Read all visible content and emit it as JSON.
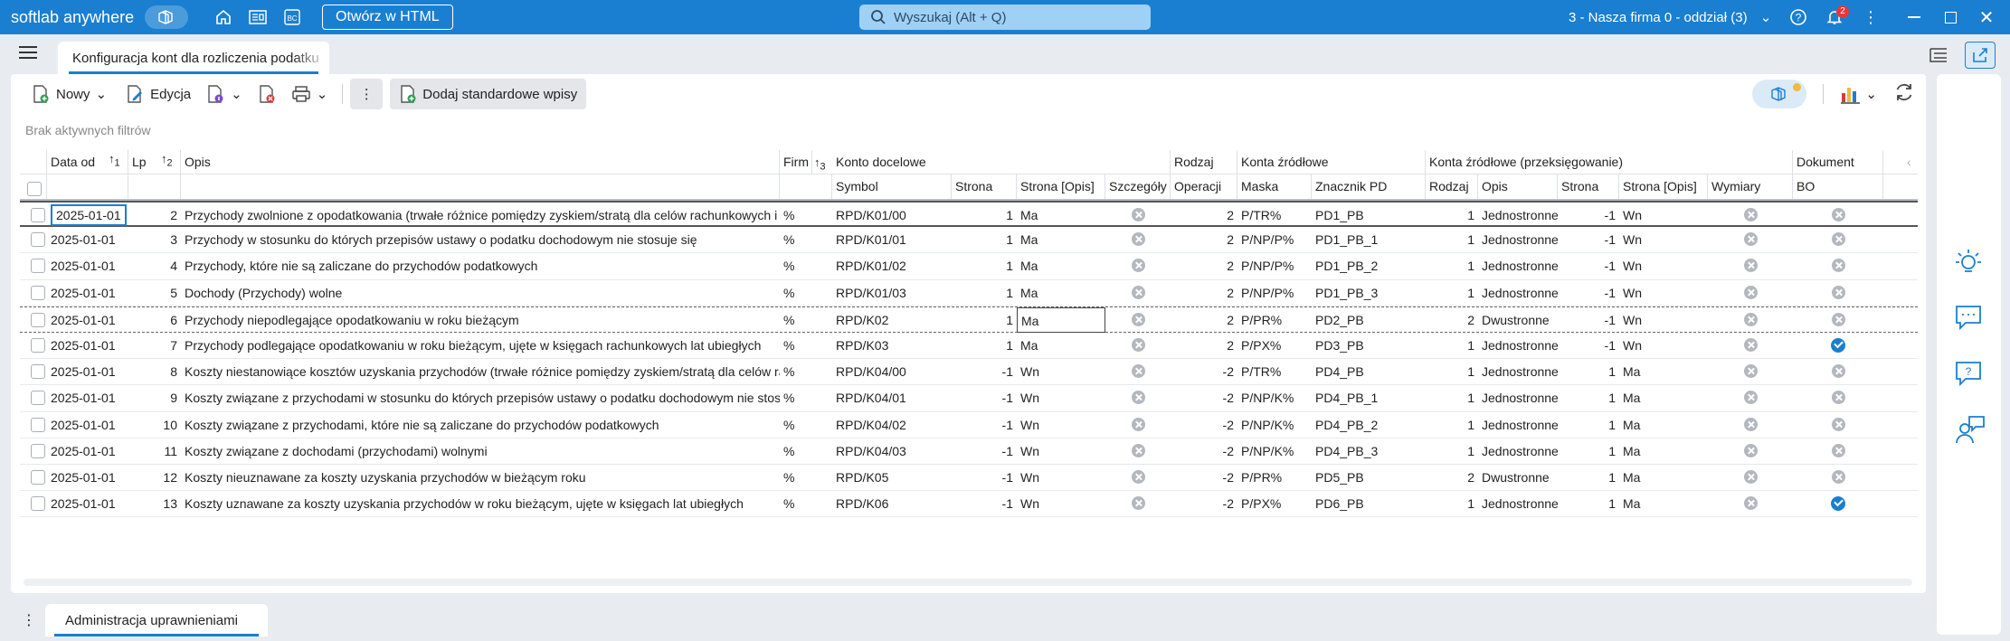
{
  "app": {
    "brand": "softlab anywhere",
    "html_button": "Otwórz w HTML",
    "search_placeholder": "Wyszukaj (Alt + Q)",
    "company": "3 - Nasza firma 0 - oddział (3)",
    "notifications": "2"
  },
  "tab": {
    "title": "Konfiguracja kont dla rozliczenia podatku"
  },
  "toolbar": {
    "new": "Nowy",
    "edit": "Edycja",
    "add_standard": "Dodaj standardowe wpisy"
  },
  "filters": "Brak aktywnych filtrów",
  "header_groups": {
    "data_od": "Data od",
    "lp": "Lp",
    "opis": "Opis",
    "firm": "Firm",
    "konto": "Konto docelowe",
    "rodzaj": "Rodzaj",
    "zrodlowe": "Konta źródłowe",
    "przeks": "Konta źródłowe (przeksięgowanie)",
    "dokument": "Dokument"
  },
  "sort_icons": {
    "data_od": "1",
    "lp": "2",
    "firm": "3"
  },
  "header_cols": {
    "symbol": "Symbol",
    "strona": "Strona",
    "strona_opis": "Strona [Opis]",
    "szczegoly": "Szczegóły",
    "operacji": "Operacji",
    "maska": "Maska",
    "znacznik": "Znacznik PD",
    "rodzaj2": "Rodzaj",
    "opis2": "Opis",
    "strona2": "Strona",
    "strona_opis2": "Strona [Opis]",
    "wymiary": "Wymiary",
    "bo": "BO"
  },
  "rows": [
    {
      "date": "2025-01-01",
      "lp": "2",
      "opis": "Przychody zwolnione z opodatkowania (trwałe różnice pomiędzy zyskiem/stratą dla celów rachunkowych i podatkowych)",
      "firm": "%",
      "symbol": "RPD/K01/00",
      "strona": "1",
      "strona_opis": "Ma",
      "operacji": "2",
      "maska": "P/TR%",
      "znacznik": "PD1_PB",
      "rodzaj": "1",
      "opis2": "Jednostronne",
      "strona2": "-1",
      "strona_opis2": "Wn",
      "bo": "x"
    },
    {
      "date": "2025-01-01",
      "lp": "3",
      "opis": "Przychody w stosunku do których przepisów ustawy o podatku dochodowym nie stosuje się",
      "firm": "%",
      "symbol": "RPD/K01/01",
      "strona": "1",
      "strona_opis": "Ma",
      "operacji": "2",
      "maska": "P/NP/P%",
      "znacznik": "PD1_PB_1",
      "rodzaj": "1",
      "opis2": "Jednostronne",
      "strona2": "-1",
      "strona_opis2": "Wn",
      "bo": "x"
    },
    {
      "date": "2025-01-01",
      "lp": "4",
      "opis": "Przychody, które nie są zaliczane do przychodów podatkowych",
      "firm": "%",
      "symbol": "RPD/K01/02",
      "strona": "1",
      "strona_opis": "Ma",
      "operacji": "2",
      "maska": "P/NP/P%",
      "znacznik": "PD1_PB_2",
      "rodzaj": "1",
      "opis2": "Jednostronne",
      "strona2": "-1",
      "strona_opis2": "Wn",
      "bo": "x"
    },
    {
      "date": "2025-01-01",
      "lp": "5",
      "opis": "Dochody (Przychody) wolne",
      "firm": "%",
      "symbol": "RPD/K01/03",
      "strona": "1",
      "strona_opis": "Ma",
      "operacji": "2",
      "maska": "P/NP/P%",
      "znacznik": "PD1_PB_3",
      "rodzaj": "1",
      "opis2": "Jednostronne",
      "strona2": "-1",
      "strona_opis2": "Wn",
      "bo": "x"
    },
    {
      "date": "2025-01-01",
      "lp": "6",
      "opis": "Przychody niepodlegające opodatkowaniu w roku bieżącym",
      "firm": "%",
      "symbol": "RPD/K02",
      "strona": "1",
      "strona_opis": "Ma",
      "operacji": "2",
      "maska": "P/PR%",
      "znacznik": "PD2_PB",
      "rodzaj": "2",
      "opis2": "Dwustronne",
      "strona2": "-1",
      "strona_opis2": "Wn",
      "bo": "x"
    },
    {
      "date": "2025-01-01",
      "lp": "7",
      "opis": "Przychody podlegające opodatkowaniu w roku bieżącym, ujęte w księgach rachunkowych lat ubiegłych",
      "firm": "%",
      "symbol": "RPD/K03",
      "strona": "1",
      "strona_opis": "Ma",
      "operacji": "2",
      "maska": "P/PX%",
      "znacznik": "PD3_PB",
      "rodzaj": "1",
      "opis2": "Jednostronne",
      "strona2": "-1",
      "strona_opis2": "Wn",
      "bo": "check"
    },
    {
      "date": "2025-01-01",
      "lp": "8",
      "opis": "Koszty niestanowiące kosztów uzyskania przychodów (trwałe różnice pomiędzy zyskiem/stratą dla celów rachunkowych)",
      "firm": "%",
      "symbol": "RPD/K04/00",
      "strona": "-1",
      "strona_opis": "Wn",
      "operacji": "-2",
      "maska": "P/TR%",
      "znacznik": "PD4_PB",
      "rodzaj": "1",
      "opis2": "Jednostronne",
      "strona2": "1",
      "strona_opis2": "Ma",
      "bo": "x"
    },
    {
      "date": "2025-01-01",
      "lp": "9",
      "opis": "Koszty związane z przychodami w stosunku do których przepisów ustawy o podatku dochodowym nie stosuje się",
      "firm": "%",
      "symbol": "RPD/K04/01",
      "strona": "-1",
      "strona_opis": "Wn",
      "operacji": "-2",
      "maska": "P/NP/K%",
      "znacznik": "PD4_PB_1",
      "rodzaj": "1",
      "opis2": "Jednostronne",
      "strona2": "1",
      "strona_opis2": "Ma",
      "bo": "x"
    },
    {
      "date": "2025-01-01",
      "lp": "10",
      "opis": "Koszty związane z przychodami, które nie są zaliczane do przychodów podatkowych",
      "firm": "%",
      "symbol": "RPD/K04/02",
      "strona": "-1",
      "strona_opis": "Wn",
      "operacji": "-2",
      "maska": "P/NP/K%",
      "znacznik": "PD4_PB_2",
      "rodzaj": "1",
      "opis2": "Jednostronne",
      "strona2": "1",
      "strona_opis2": "Ma",
      "bo": "x"
    },
    {
      "date": "2025-01-01",
      "lp": "11",
      "opis": "Koszty związane z dochodami (przychodami) wolnymi",
      "firm": "%",
      "symbol": "RPD/K04/03",
      "strona": "-1",
      "strona_opis": "Wn",
      "operacji": "-2",
      "maska": "P/NP/K%",
      "znacznik": "PD4_PB_3",
      "rodzaj": "1",
      "opis2": "Jednostronne",
      "strona2": "1",
      "strona_opis2": "Ma",
      "bo": "x"
    },
    {
      "date": "2025-01-01",
      "lp": "12",
      "opis": "Koszty nieuznawane za koszty uzyskania przychodów w bieżącym roku",
      "firm": "%",
      "symbol": "RPD/K05",
      "strona": "-1",
      "strona_opis": "Wn",
      "operacji": "-2",
      "maska": "P/PR%",
      "znacznik": "PD5_PB",
      "rodzaj": "2",
      "opis2": "Dwustronne",
      "strona2": "1",
      "strona_opis2": "Ma",
      "bo": "x"
    },
    {
      "date": "2025-01-01",
      "lp": "13",
      "opis": "Koszty uznawane za koszty uzyskania przychodów w roku bieżącym, ujęte w księgach lat ubiegłych",
      "firm": "%",
      "symbol": "RPD/K06",
      "strona": "-1",
      "strona_opis": "Wn",
      "operacji": "-2",
      "maska": "P/PX%",
      "znacznik": "PD6_PB",
      "rodzaj": "1",
      "opis2": "Jednostronne",
      "strona2": "1",
      "strona_opis2": "Ma",
      "bo": "check"
    }
  ],
  "bottom_tab": {
    "title": "Administracja uprawnieniami"
  },
  "colors": {
    "accent": "#1a7fd0",
    "badge": "#e53935"
  }
}
